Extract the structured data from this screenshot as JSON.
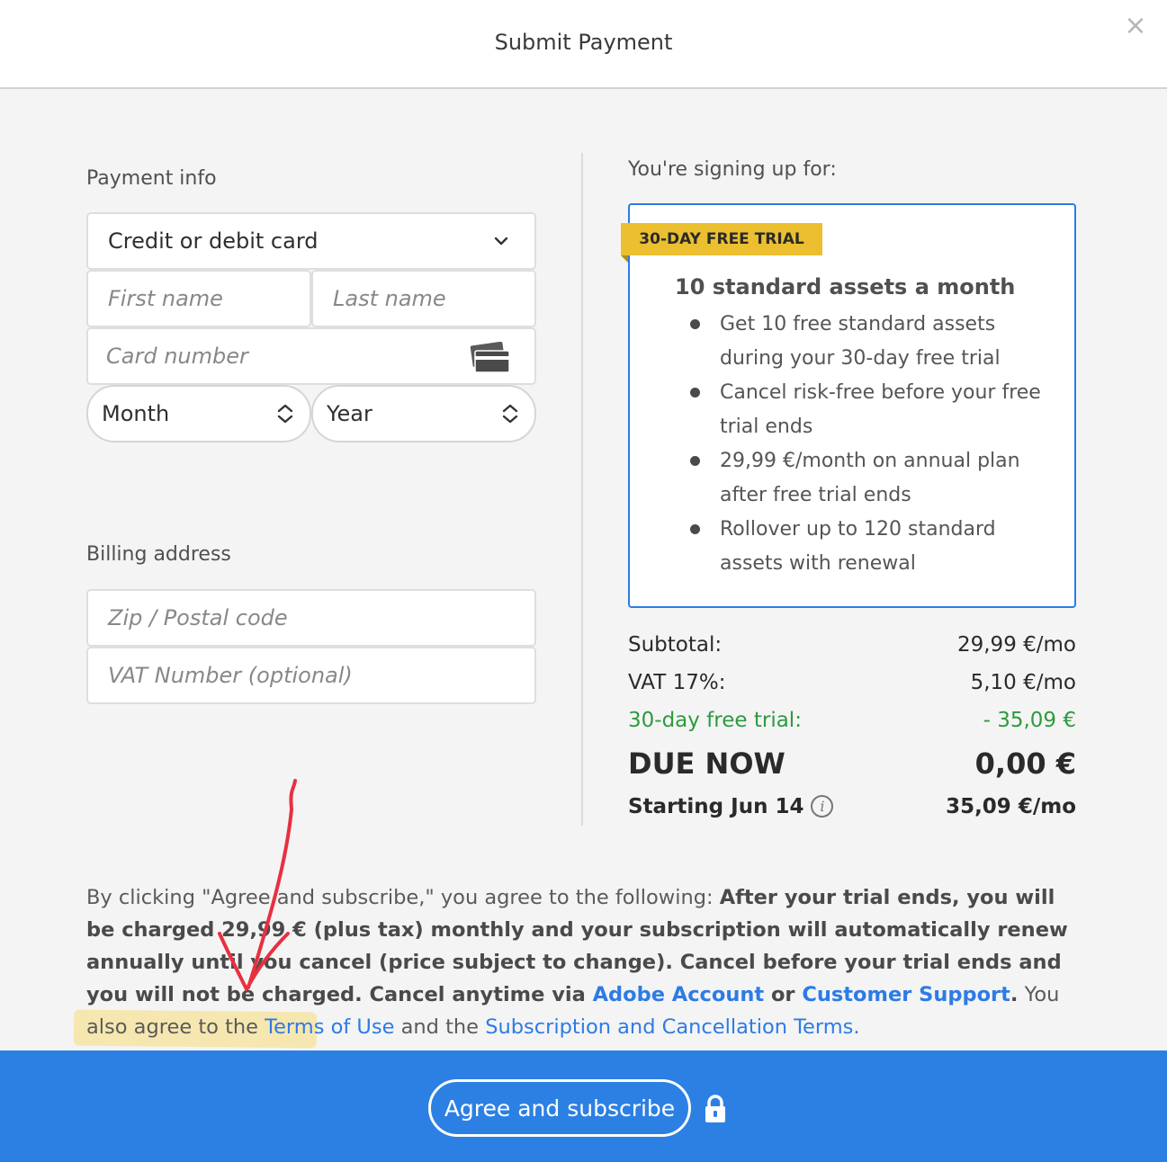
{
  "header": {
    "title": "Submit Payment",
    "close_icon": "close-icon"
  },
  "payment": {
    "section_label": "Payment info",
    "method_value": "Credit or debit card",
    "first_name_placeholder": "First name",
    "last_name_placeholder": "Last name",
    "card_number_placeholder": "Card number",
    "month_value": "Month",
    "year_value": "Year"
  },
  "billing": {
    "section_label": "Billing address",
    "zip_placeholder": "Zip / Postal code",
    "vat_placeholder": "VAT Number (optional)"
  },
  "plan": {
    "signup_label": "You're signing up for:",
    "badge": "30-DAY FREE TRIAL",
    "heading": "10 standard assets a month",
    "benefits": [
      "Get 10 free standard assets during your 30-day free trial",
      "Cancel risk-free before your free trial ends",
      "29,99 €/month on annual plan after free trial ends",
      "Rollover up to 120 standard assets with renewal"
    ]
  },
  "summary": {
    "subtotal_label": "Subtotal:",
    "subtotal_value": "29,99 €/mo",
    "vat_label": "VAT 17%:",
    "vat_value": "5,10 €/mo",
    "trial_label": "30-day free trial:",
    "trial_value": "- 35,09 €",
    "due_label": "DUE NOW",
    "due_value": "0,00 €",
    "starting_label": "Starting Jun 14",
    "starting_value": "35,09 €/mo"
  },
  "legal": {
    "intro": "By clicking \"Agree and subscribe,\" you agree to the following: ",
    "bold_text": "After your trial ends, you will be charged 29,99 € (plus tax) monthly and your subscription will automatically renew annually until you cancel (price subject to change). Cancel before your trial ends and you will not be charged. Cancel anytime via ",
    "adobe_account_link": "Adobe Account",
    "or_text": " or ",
    "support_link": "Customer Support",
    "period": ".",
    "also_text": " You also agree to the ",
    "terms_link": "Terms of Use",
    "and_text": " and the ",
    "subscription_link": "Subscription and Cancellation Terms."
  },
  "footer": {
    "agree_label": "Agree and subscribe"
  },
  "colors": {
    "accent_blue": "#2c80e4",
    "trial_green": "#2e9a3e",
    "badge_yellow": "#ebbf2f",
    "annotation_red": "#e8303f",
    "highlight_yellow": "#f7dd78"
  }
}
